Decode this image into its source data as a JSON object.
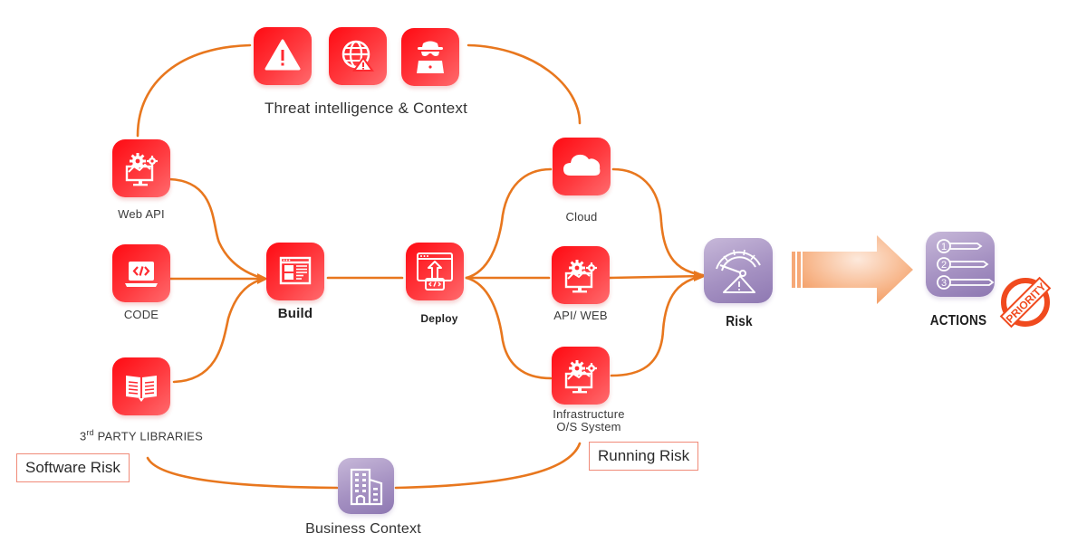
{
  "title_section": {
    "label": "Threat intelligence & Context",
    "icons": [
      "warning-triangle-icon",
      "globe-warning-icon",
      "hacker-laptop-icon"
    ]
  },
  "sources": [
    {
      "label": "Web API",
      "icon": "monitor-gears-icon"
    },
    {
      "label": "CODE",
      "icon": "laptop-code-icon"
    },
    {
      "label_main": "3",
      "label_sup": "rd",
      "label_rest": " PARTY LIBRARIES",
      "icon": "open-book-icon"
    }
  ],
  "build": {
    "label": "Build",
    "icon": "web-layout-icon"
  },
  "deploy": {
    "label": "Deploy",
    "icon": "browser-upload-code-icon"
  },
  "targets": [
    {
      "label": "Cloud",
      "icon": "cloud-icon"
    },
    {
      "label": "API/ WEB",
      "icon": "monitor-gears-icon"
    },
    {
      "label_line1": "Infrastructure",
      "label_line2": "O/S System",
      "icon": "monitor-gears-icon"
    }
  ],
  "risk": {
    "label": "Risk",
    "icon": "gauge-warning-icon"
  },
  "actions": {
    "label": "ACTIONS",
    "icon": "numbered-list-icon",
    "list_numbers": [
      "1",
      "2",
      "3"
    ]
  },
  "priority_stamp": {
    "label": "PRIORITY"
  },
  "boxes": {
    "software_risk": "Software Risk",
    "running_risk": "Running Risk"
  },
  "business": {
    "label": "Business Context",
    "icon": "office-building-icon"
  },
  "colors": {
    "connector": "#e8771e",
    "tile_red": "#ff1a20",
    "tile_purple": "#a793c4",
    "arrow": "#f6a877",
    "stamp": "#f04a1e",
    "box_border": "#f08a78"
  }
}
